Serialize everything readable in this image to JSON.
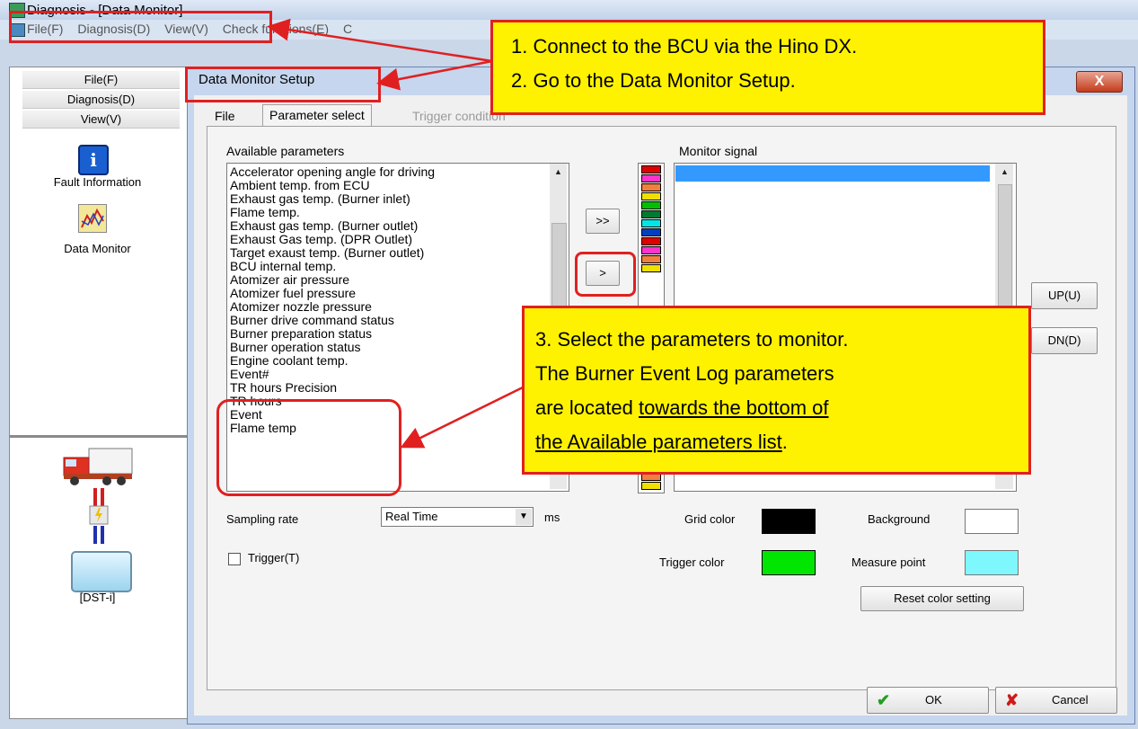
{
  "window": {
    "title": "Diagnosis - [Data Monitor]"
  },
  "menu": [
    "File(F)",
    "Diagnosis(D)",
    "View(V)",
    "Check functions(E)",
    "C"
  ],
  "leftnav": {
    "file": "File(F)",
    "diagnosis": "Diagnosis(D)",
    "view": "View(V)",
    "fault_information": "Fault Information",
    "data_monitor": "Data Monitor",
    "device": "[DST-i]"
  },
  "dialog": {
    "title": "Data Monitor Setup",
    "close": "X",
    "tabs": [
      "File",
      "Parameter select",
      "Trigger condition"
    ],
    "available_label": "Available parameters",
    "monitor_label": "Monitor signal",
    "available_parameters": [
      "Accelerator opening angle for driving",
      "Ambient temp. from ECU",
      "Exhaust gas temp. (Burner inlet)",
      "Flame temp.",
      "Exhaust gas temp. (Burner outlet)",
      "Exhaust Gas temp. (DPR Outlet)",
      "Target exaust temp. (Burner outlet)",
      "BCU internal temp.",
      "Atomizer air pressure",
      "Atomizer fuel pressure",
      "Atomizer nozzle pressure",
      "Burner drive command status",
      "Burner preparation status",
      "Burner operation status",
      "Engine coolant temp.",
      "Event#",
      "TR hours Precision",
      "TR hours",
      "Event",
      "Flame temp"
    ],
    "add_all_button": ">>",
    "add_button": ">",
    "up_button": "UP(U)",
    "down_button": "DN(D)",
    "sampling_label": "Sampling rate",
    "sampling_value": "Real Time",
    "sampling_unit": "ms",
    "trigger_label": "Trigger(T)",
    "grid_color_label": "Grid color",
    "background_label": "Background",
    "trigger_color_label": "Trigger color",
    "measure_point_label": "Measure point",
    "reset_button": "Reset color setting",
    "ok_button": "OK",
    "cancel_button": "Cancel"
  },
  "colors": {
    "grid": "#000000",
    "background": "#ffffff",
    "trigger": "#00e600",
    "measure_point": "#7ff7ff",
    "swatches_top": [
      "#e00000",
      "#ff33cc",
      "#f08040",
      "#f0e000",
      "#00c000",
      "#007a30",
      "#00e6e6",
      "#0040c0",
      "#e00000",
      "#ff33cc",
      "#f08040",
      "#f0e000"
    ],
    "swatches_bottom": [
      "#f08040",
      "#f0e000"
    ]
  },
  "callouts": {
    "step12_line1": "1. Connect to the BCU via the Hino DX.",
    "step12_line2": "2. Go to the Data Monitor Setup.",
    "step3_line1": "3. Select the parameters to monitor.",
    "step3_line2": "The Burner Event Log parameters",
    "step3_line3a": "are located ",
    "step3_line3b": "towards the bottom of",
    "step3_line4a": "the Available parameters list",
    "step3_line4b": "."
  }
}
